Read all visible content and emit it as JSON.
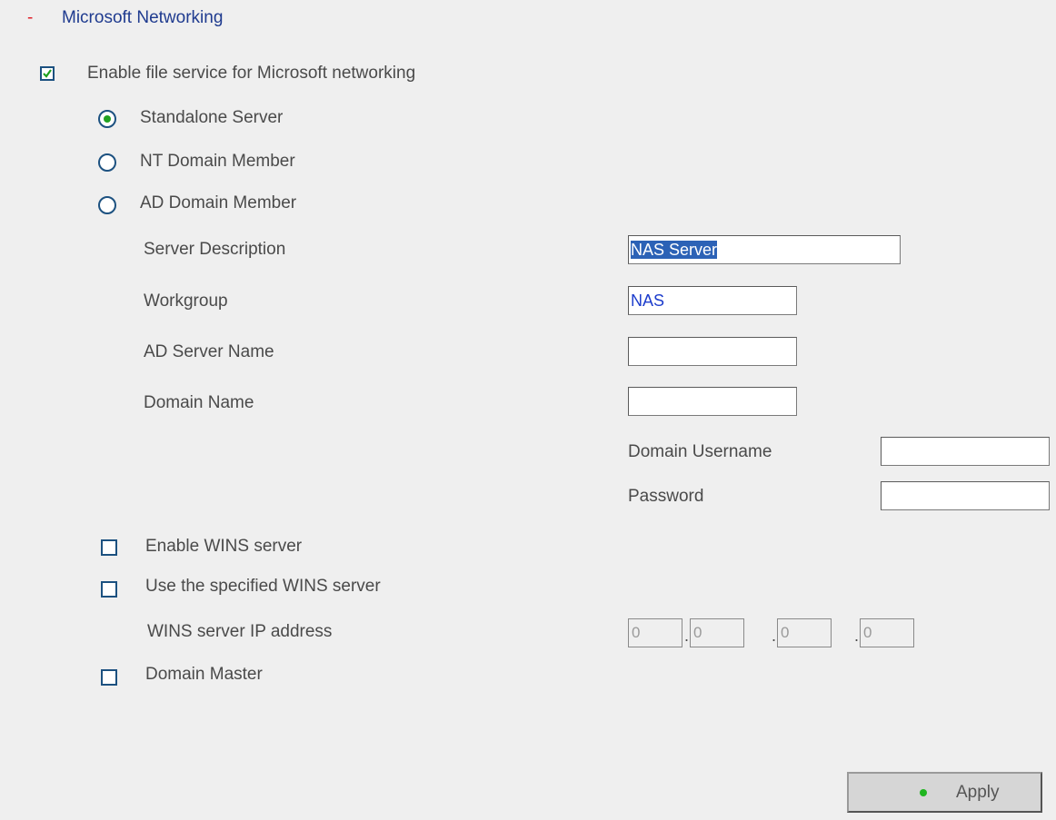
{
  "section": {
    "collapse_symbol": "-",
    "title": "Microsoft Networking"
  },
  "enable_file_service": {
    "label": "Enable file service for Microsoft networking",
    "checked": true
  },
  "server_mode": {
    "options": [
      {
        "label": "Standalone Server",
        "selected": true
      },
      {
        "label": "NT Domain Member",
        "selected": false
      },
      {
        "label": "AD Domain Member",
        "selected": false
      }
    ]
  },
  "fields": {
    "server_description": {
      "label": "Server Description",
      "value": "NAS Server"
    },
    "workgroup": {
      "label": "Workgroup",
      "value": "NAS"
    },
    "ad_server_name": {
      "label": "AD Server Name",
      "value": ""
    },
    "domain_name": {
      "label": "Domain Name",
      "value": ""
    },
    "domain_username": {
      "label": "Domain Username",
      "value": ""
    },
    "password": {
      "label": "Password",
      "value": ""
    }
  },
  "wins": {
    "enable_label": "Enable WINS server",
    "enable_checked": false,
    "use_specified_label": "Use the specified WINS server",
    "use_specified_checked": false,
    "ip_label": "WINS server IP address",
    "ip_octets": [
      "0",
      "0",
      "0",
      "0"
    ],
    "ip_separator": "."
  },
  "domain_master": {
    "label": "Domain Master",
    "checked": false
  },
  "apply_button": {
    "label": "Apply",
    "status_color": "#1fb51f"
  },
  "colors": {
    "accent": "#1f3b8f",
    "collapse": "#e0202a",
    "selection": "#2c62b6"
  }
}
